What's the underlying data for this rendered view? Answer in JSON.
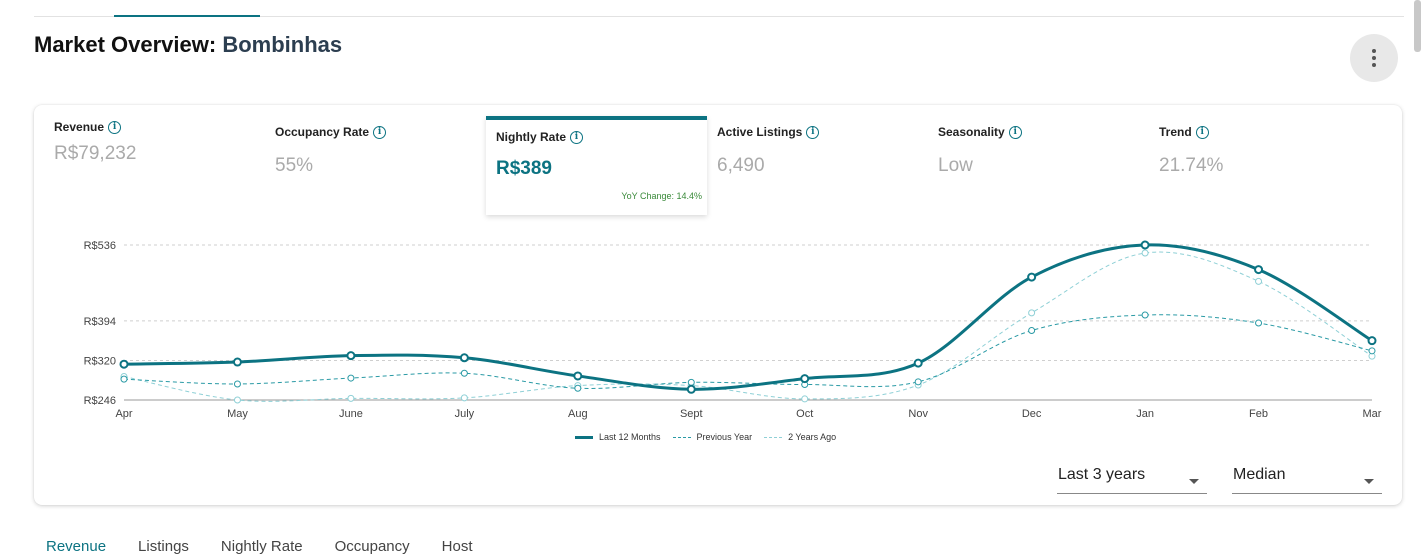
{
  "header": {
    "title_prefix": "Market Overview:",
    "location": "Bombinhas",
    "more_icon": "more-vert-icon"
  },
  "metrics": [
    {
      "label": "Revenue",
      "value": "R$79,232"
    },
    {
      "label": "Occupancy Rate",
      "value": "55%"
    },
    {
      "label": "Nightly Rate",
      "value": "R$389",
      "yoy": "YoY Change: 14.4%",
      "active": true
    },
    {
      "label": "Active Listings",
      "value": "6,490"
    },
    {
      "label": "Seasonality",
      "value": "Low"
    },
    {
      "label": "Trend",
      "value": "21.74%"
    }
  ],
  "info_icon_glyph": "i",
  "chart_data": {
    "type": "line",
    "categories": [
      "Apr",
      "May",
      "June",
      "July",
      "Aug",
      "Sept",
      "Oct",
      "Nov",
      "Dec",
      "Jan",
      "Feb",
      "Mar"
    ],
    "y_ticks": [
      "R$536",
      "R$394",
      "R$320",
      "R$246"
    ],
    "y_tick_values": [
      536,
      394,
      320,
      246
    ],
    "ylim": [
      246,
      536
    ],
    "series": [
      {
        "name": "Last 12 Months",
        "style": "solid",
        "color": "#0c7382",
        "values": [
          313,
          317,
          329,
          325,
          291,
          266,
          286,
          315,
          476,
          536,
          490,
          357
        ]
      },
      {
        "name": "Previous Year",
        "style": "dashed",
        "color": "#2a9aa5",
        "values": [
          285,
          276,
          287,
          296,
          268,
          279,
          275,
          280,
          376,
          405,
          390,
          338
        ]
      },
      {
        "name": "2 Years Ago",
        "style": "dashed",
        "color": "#8fd0d6",
        "values": [
          290,
          246,
          249,
          250,
          273,
          273,
          248,
          274,
          409,
          521,
          468,
          328
        ]
      }
    ],
    "grid": true,
    "legend": "bottom-center"
  },
  "controls": {
    "period": "Last 3 years",
    "statistic": "Median"
  },
  "bottom_tabs": [
    "Revenue",
    "Listings",
    "Nightly Rate",
    "Occupancy",
    "Host"
  ]
}
